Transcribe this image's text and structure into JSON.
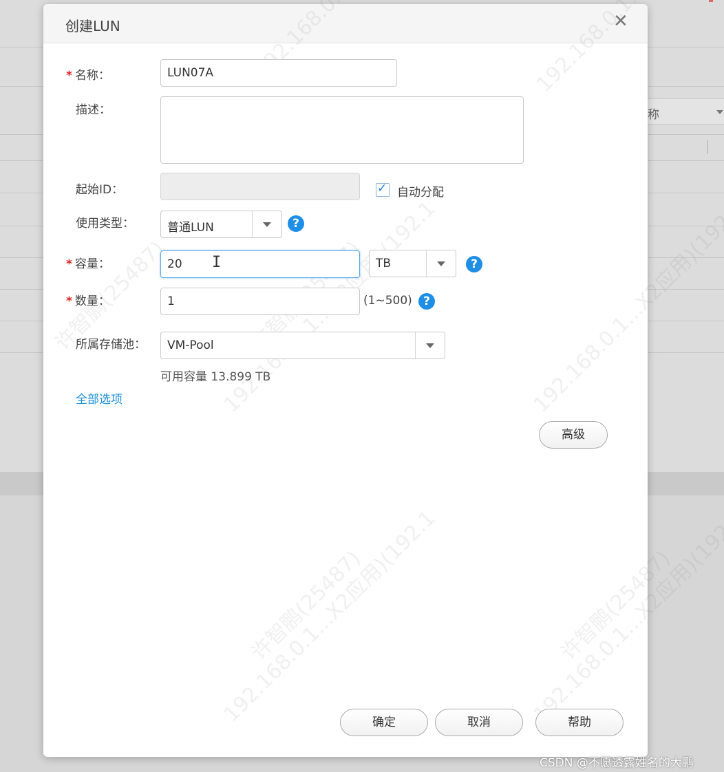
{
  "background": {
    "select_label": "称"
  },
  "dialog": {
    "title": "创建LUN",
    "close_glyph": "✕"
  },
  "form": {
    "required_mark": "*",
    "name": {
      "label": "名称：",
      "value": "LUN07A"
    },
    "description": {
      "label": "描述：",
      "value": ""
    },
    "start_id": {
      "label": "起始ID：",
      "value": "",
      "auto_assign_label": "自动分配",
      "auto_assign_checked": true
    },
    "usage_type": {
      "label": "使用类型：",
      "value": "普通LUN"
    },
    "capacity": {
      "label": "容量：",
      "value": "20",
      "unit": "TB"
    },
    "quantity": {
      "label": "数量：",
      "value": "1",
      "range_hint": "(1~500)"
    },
    "storage_pool": {
      "label": "所属存储池：",
      "value": "VM-Pool",
      "available_capacity": "可用容量 13.899 TB"
    },
    "help_glyph": "?",
    "all_options_link": "全部选项"
  },
  "buttons": {
    "advanced": "高级",
    "ok": "确定",
    "cancel": "取消",
    "help": "帮助"
  },
  "watermark": {
    "line1": "许智鹏(25487)",
    "line2": "192.168.0.1...X2应用)(192.1",
    "line3": "192.168.0.1..."
  },
  "credit": "CSDN @不愿透露姓名的大鹏",
  "colors": {
    "accent": "#1e8ee6",
    "required": "#dd2222",
    "link": "#1a8fd9"
  }
}
